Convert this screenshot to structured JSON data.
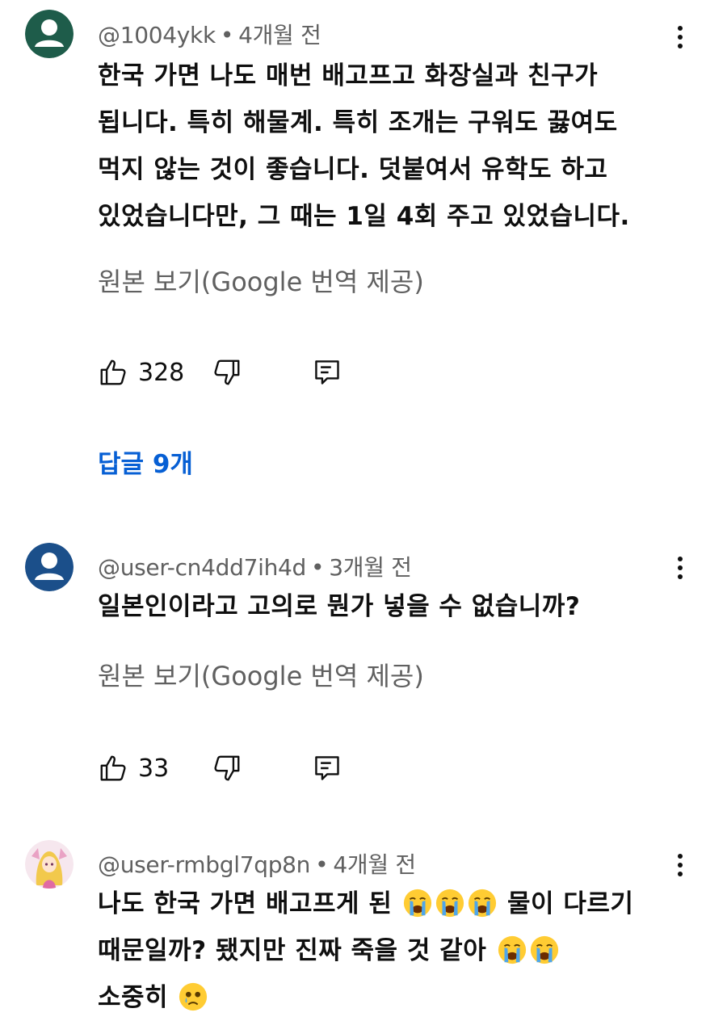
{
  "comments": [
    {
      "handle": "@1004ykk",
      "separator": "•",
      "time": "4개월 전",
      "avatar_color": "#1e5c4a",
      "lines": [
        "한국 가면 나도 매번 배고프고 화장실과 친구가",
        "됩니다. 특히 해물계. 특히 조개는 구워도 끓여도",
        "먹지 않는 것이 좋습니다. 덧붙여서 유학도 하고",
        "있었습니다만, 그 때는 1일 4회 주고 있었습니다."
      ],
      "translate_label": "원본 보기(Google 번역 제공)",
      "likes": "328",
      "replies_label": "답글 9개"
    },
    {
      "handle": "@user-cn4dd7ih4d",
      "separator": "•",
      "time": "3개월 전",
      "avatar_color": "#1b4f8a",
      "lines": [
        "일본인이라고 고의로 뭔가 넣을 수 없습니까?"
      ],
      "translate_label": "원본 보기(Google 번역 제공)",
      "likes": "33"
    },
    {
      "handle": "@user-rmbgl7qp8n",
      "separator": "•",
      "time": "4개월 전",
      "line1_before": "나도 한국 가면 배고프게 된",
      "line1_after": "물이 다르기",
      "line2_before": "때문일까? 됐지만 진짜 죽을 것 같아",
      "line3_before": "소중히",
      "emojis": [
        "loudly-crying-face",
        "loudly-crying-face",
        "loudly-crying-face",
        "loudly-crying-face",
        "loudly-crying-face",
        "sad-tear-face"
      ]
    }
  ],
  "colors": {
    "link_blue": "#065fd4",
    "secondary_text": "#606060"
  }
}
